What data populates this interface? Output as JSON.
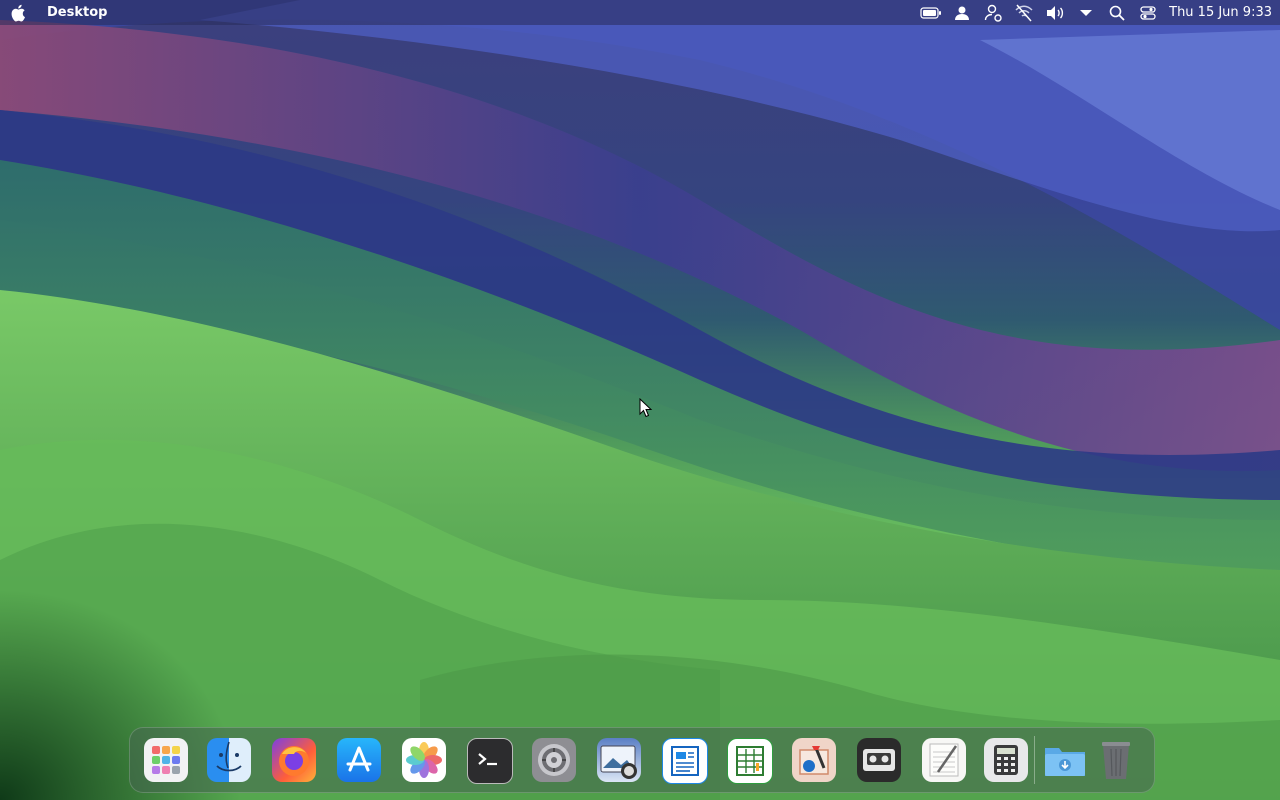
{
  "menubar": {
    "app_name": "Desktop",
    "clock": "Thu 15 Jun 9:33",
    "status_icons": [
      "battery-icon",
      "user-icon",
      "accounts-icon",
      "wifi-off-icon",
      "volume-icon",
      "dropdown-icon",
      "search-icon",
      "control-center-icon"
    ]
  },
  "dock": {
    "apps": [
      "launchpad",
      "finder",
      "firefox",
      "app-store",
      "photos",
      "terminal",
      "system-settings",
      "screenshot",
      "text-document",
      "spreadsheet",
      "image-editor",
      "tape-recorder",
      "text-editor",
      "calculator",
      "downloads-folder",
      "trash"
    ]
  },
  "colors": {
    "wallpaper_top": "#3c3f7e",
    "wallpaper_green": "#69bf5e",
    "accent_blue": "#1e88e5"
  }
}
